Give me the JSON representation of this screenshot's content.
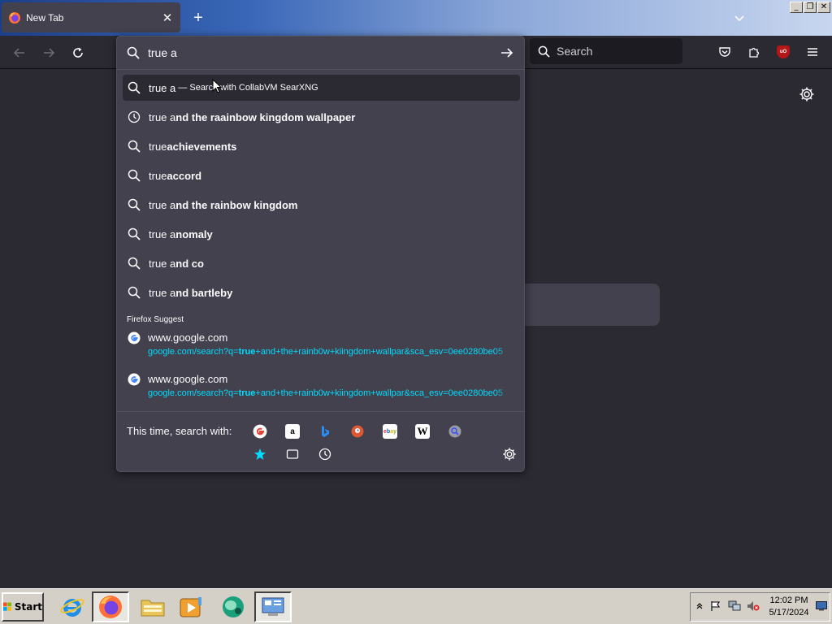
{
  "tab": {
    "title": "New Tab",
    "close_icon": "close-icon",
    "favicon": "firefox-icon"
  },
  "new_tab_label": "+",
  "window_controls": {
    "minimize": "_",
    "restore": "❐",
    "close": "✕"
  },
  "navbar": {
    "back_icon": "back-arrow-icon",
    "forward_icon": "forward-arrow-icon",
    "reload_icon": "reload-icon",
    "search_placeholder": "Search"
  },
  "urlbar": {
    "value": "true a",
    "results": [
      {
        "typed": "true a",
        "suffix": "",
        "action": " — Search with CollabVM SearXNG",
        "icon": "search-icon",
        "selected": true
      },
      {
        "typed": "true a",
        "suffix": "nd the raainbow kingdom wallpaper",
        "icon": "history-icon"
      },
      {
        "typed": "true",
        "suffix": "achievements",
        "icon": "search-icon"
      },
      {
        "typed": "true",
        "suffix": "accord",
        "icon": "search-icon"
      },
      {
        "typed": "true a",
        "suffix": "nd the rainbow kingdom",
        "icon": "search-icon"
      },
      {
        "typed": "true a",
        "suffix": "nomaly",
        "icon": "search-icon"
      },
      {
        "typed": "true a",
        "suffix": "nd co",
        "icon": "search-icon"
      },
      {
        "typed": "true a",
        "suffix": "nd bartleby",
        "icon": "search-icon"
      }
    ],
    "suggest_group_label": "Firefox Suggest",
    "suggestions": [
      {
        "title": "www.google.com",
        "url_prefix": "google.com/search?q=",
        "url_bold": "true",
        "url_rest": "+and+the+rainb0w+kiingdom+wallpar&sca_esv=0ee0280be05"
      },
      {
        "title": "www.google.com",
        "url_prefix": "google.com/search?q=",
        "url_bold": "true",
        "url_rest": "+and+the+rainb0w+kiingdom+wallpar&sca_esv=0ee0280be05"
      }
    ],
    "oneoff_label": "This time, search with:",
    "engines": [
      "google-icon",
      "amazon-icon",
      "bing-icon",
      "duckduckgo-icon",
      "ebay-icon",
      "wikipedia-icon",
      "searxng-icon"
    ],
    "modes": [
      "bookmarks-star-icon",
      "tabs-icon",
      "history-icon"
    ]
  },
  "taskbar": {
    "start_label": "Start",
    "apps": [
      "internet-explorer-icon",
      "firefox-icon",
      "explorer-folder-icon",
      "media-player-icon",
      "app-globe-icon",
      "control-panel-icon"
    ],
    "clock_time": "12:02 PM",
    "clock_date": "5/17/2024"
  },
  "colors": {
    "accent_cyan": "#00ddff",
    "panel_bg": "#42414d",
    "page_bg": "#2b2a33"
  }
}
